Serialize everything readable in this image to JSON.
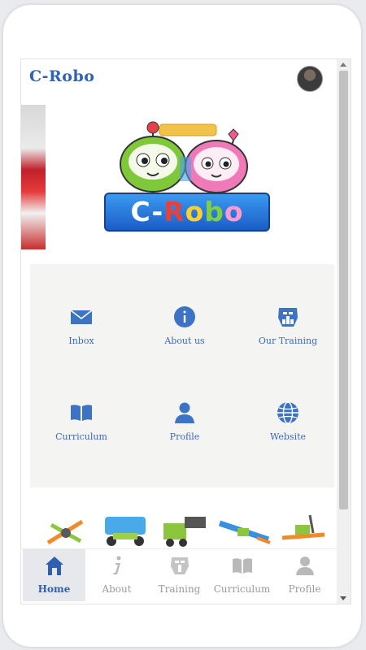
{
  "app": {
    "title": "C-Robo"
  },
  "logo": {
    "text": "C-Robo"
  },
  "menu": {
    "items": [
      {
        "label": "Inbox",
        "icon": "envelope-icon"
      },
      {
        "label": "About us",
        "icon": "info-icon"
      },
      {
        "label": "Our Training",
        "icon": "robot-head-icon"
      },
      {
        "label": "Curriculum",
        "icon": "book-icon"
      },
      {
        "label": "Profile",
        "icon": "user-icon"
      },
      {
        "label": "Website",
        "icon": "globe-icon"
      }
    ]
  },
  "tabs": [
    {
      "label": "Home",
      "icon": "home-icon",
      "active": true
    },
    {
      "label": "About",
      "icon": "info-italic-icon"
    },
    {
      "label": "Training",
      "icon": "robot-head-icon"
    },
    {
      "label": "Curriculum",
      "icon": "book-icon"
    },
    {
      "label": "Profile",
      "icon": "user-icon"
    }
  ],
  "colors": {
    "accent": "#2f63b6",
    "icon_blue": "#3d73c4",
    "tab_inactive": "#b9b9b9",
    "grid_bg": "#f4f4f2"
  }
}
